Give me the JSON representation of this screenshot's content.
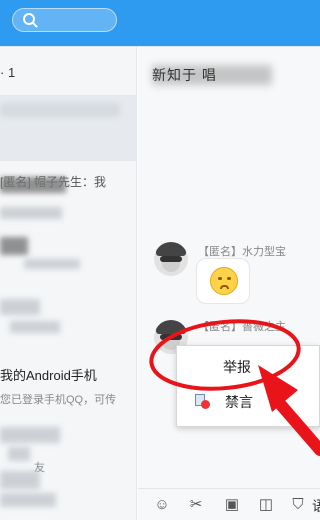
{
  "sidebar": {
    "header": "· 1",
    "message_preview": "[匿名] 帽子先生：我",
    "android_title": "我的Android手机",
    "android_message": "您已登录手机QQ，可传",
    "last_preview": "友"
  },
  "chat": {
    "title": "新知于 唱",
    "messages": [
      {
        "sender": "【匿名】水力型宝"
      },
      {
        "sender": "【匿名】薔薇之主"
      }
    ]
  },
  "context_menu": {
    "items": [
      {
        "label": "举报"
      },
      {
        "label": "禁言"
      }
    ]
  },
  "toolbar": {
    "icons": [
      "emoji-icon",
      "scissors-icon",
      "image-icon",
      "gift-icon",
      "shield-icon"
    ],
    "more_label": "语"
  },
  "colors": {
    "topbar": "#2e9bf0",
    "annotation": "#e8141a"
  }
}
